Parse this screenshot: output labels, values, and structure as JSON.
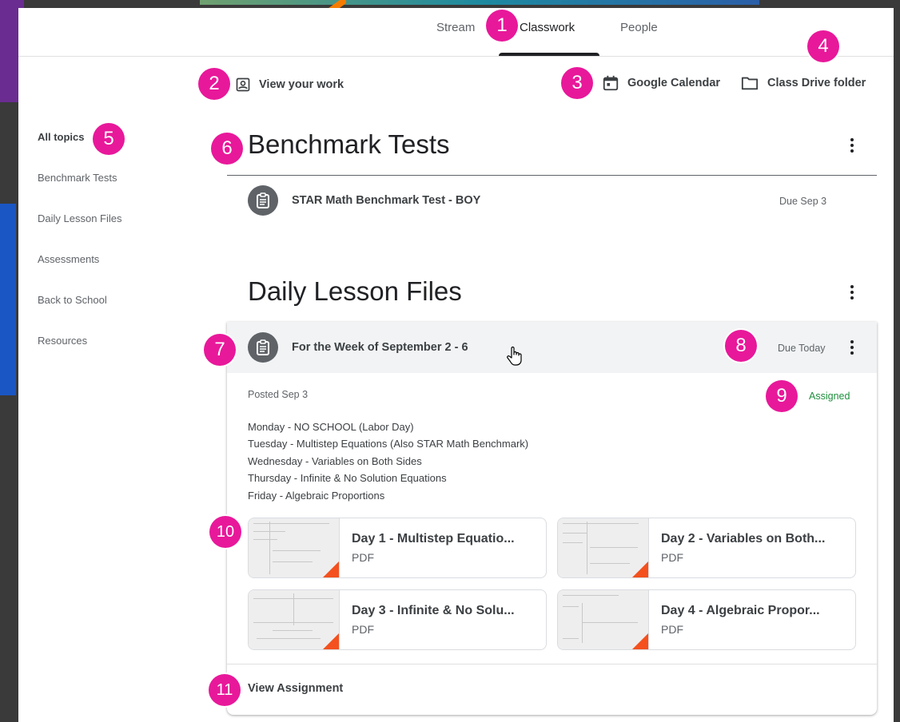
{
  "tabs": [
    {
      "label": "Stream"
    },
    {
      "label": "Classwork"
    },
    {
      "label": "People"
    }
  ],
  "actions": {
    "view_work": "View your work",
    "calendar": "Google Calendar",
    "drive": "Class Drive folder"
  },
  "sidebar": {
    "items": [
      {
        "label": "All topics"
      },
      {
        "label": "Benchmark Tests"
      },
      {
        "label": "Daily Lesson Files"
      },
      {
        "label": "Assessments"
      },
      {
        "label": "Back to School"
      },
      {
        "label": "Resources"
      }
    ]
  },
  "topics": [
    {
      "title": "Benchmark Tests",
      "items": [
        {
          "title": "STAR Math Benchmark Test - BOY",
          "due": "Due Sep 3"
        }
      ]
    },
    {
      "title": "Daily Lesson Files",
      "items": [
        {
          "title": "For the Week of September 2 - 6",
          "due": "Due Today",
          "posted": "Posted Sep 3",
          "status": "Assigned",
          "description": [
            "Monday - NO SCHOOL (Labor Day)",
            "Tuesday - Multistep Equations (Also STAR Math Benchmark)",
            "Wednesday - Variables on Both Sides",
            "Thursday - Infinite & No Solution Equations",
            "Friday - Algebraic Proportions"
          ],
          "attachments": [
            {
              "title": "Day 1 - Multistep Equatio...",
              "type": "PDF"
            },
            {
              "title": "Day 2 - Variables on Both...",
              "type": "PDF"
            },
            {
              "title": "Day 3 - Infinite & No Solu...",
              "type": "PDF"
            },
            {
              "title": "Day 4 - Algebraic Propor...",
              "type": "PDF"
            }
          ],
          "view_label": "View Assignment"
        }
      ]
    }
  ],
  "badges": [
    "1",
    "2",
    "3",
    "4",
    "5",
    "6",
    "7",
    "8",
    "9",
    "10",
    "11"
  ],
  "colors": {
    "badge": "#e8189a",
    "assigned": "#1e8e3e",
    "pdf_corner": "#f4511e"
  }
}
